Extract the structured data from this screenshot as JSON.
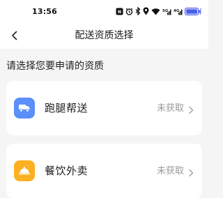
{
  "status_bar": {
    "time": "13:56",
    "icons": [
      "nfc-icon",
      "alarm-icon",
      "bluetooth-icon",
      "location-icon",
      "wifi-icon",
      "signal-5g-icon",
      "signal-icon",
      "battery-charging-icon"
    ]
  },
  "nav": {
    "title": "配送资质选择",
    "back_icon": "chevron-left-icon"
  },
  "section": {
    "label": "请选择您要申请的资质"
  },
  "qualifications": [
    {
      "name": "跑腿帮送",
      "status": "未获取",
      "icon": "delivery-truck-icon",
      "icon_color": "#5b8ff9"
    },
    {
      "name": "餐饮外卖",
      "status": "未获取",
      "icon": "food-cloche-icon",
      "icon_color": "#fdb022"
    }
  ],
  "colors": {
    "background": "#f5f5f5",
    "card": "#ffffff",
    "status_text": "#999999",
    "battery": "#4a5fe8"
  }
}
